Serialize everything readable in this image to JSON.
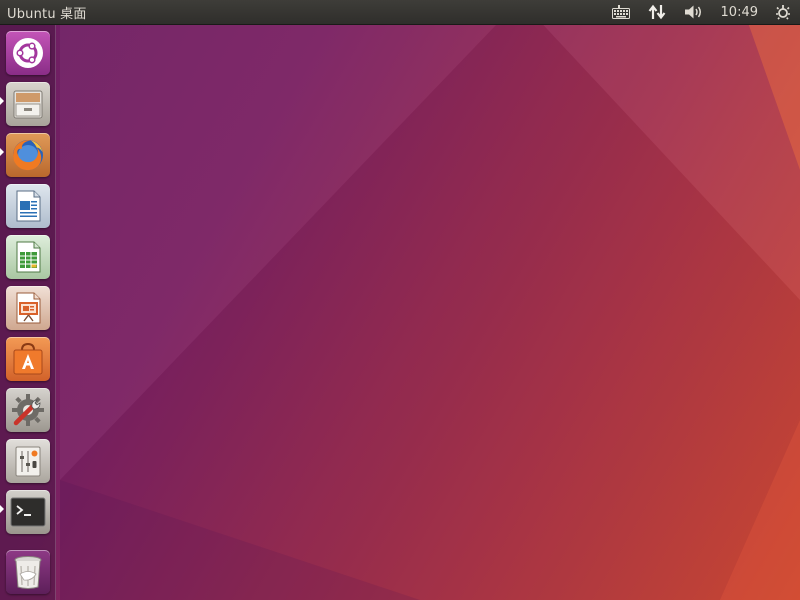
{
  "top_panel": {
    "title": "Ubuntu 桌面",
    "clock": "10:49",
    "indicators": [
      "keyboard-icon",
      "network-updown-icon",
      "volume-icon",
      "power-gear-icon"
    ]
  },
  "launcher": {
    "items": [
      {
        "name": "dash-home",
        "icon": "ubuntu-logo-icon",
        "running": false
      },
      {
        "name": "files",
        "icon": "file-cabinet-icon",
        "running": true
      },
      {
        "name": "firefox",
        "icon": "firefox-icon",
        "running": true
      },
      {
        "name": "libreoffice-writer",
        "icon": "writer-icon",
        "running": false
      },
      {
        "name": "libreoffice-calc",
        "icon": "calc-icon",
        "running": false
      },
      {
        "name": "libreoffice-impress",
        "icon": "impress-icon",
        "running": false
      },
      {
        "name": "ubuntu-software",
        "icon": "software-bag-icon",
        "running": false
      },
      {
        "name": "system-settings",
        "icon": "settings-wrench-icon",
        "running": false
      },
      {
        "name": "system-monitor",
        "icon": "sliders-icon",
        "running": false
      },
      {
        "name": "terminal",
        "icon": "terminal-icon",
        "running": true
      },
      {
        "name": "trash",
        "icon": "trash-icon",
        "running": false
      }
    ]
  },
  "colors": {
    "wallpaper_left": "#6c1e63",
    "wallpaper_right": "#d14a34",
    "panel": "#3a3935",
    "panel_text": "#dfdbd2"
  }
}
